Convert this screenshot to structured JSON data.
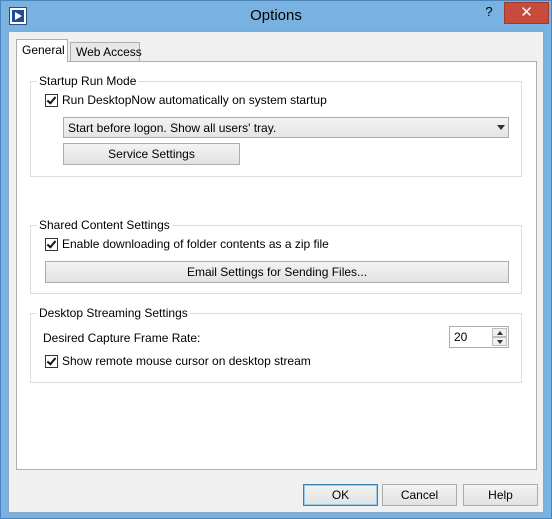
{
  "window": {
    "title": "Options",
    "help_glyph": "?",
    "close_glyph": "✕"
  },
  "tabs": [
    {
      "label": "General",
      "active": true
    },
    {
      "label": "Web Access",
      "active": false
    }
  ],
  "startup": {
    "group_title": "Startup Run Mode",
    "run_checkbox_label": "Run DesktopNow automatically on system startup",
    "run_checked": true,
    "mode_selected": "Start before logon. Show all users' tray.",
    "service_button": "Service Settings"
  },
  "shared": {
    "group_title": "Shared Content Settings",
    "zip_checkbox_label": "Enable downloading of folder contents as a zip file",
    "zip_checked": true,
    "email_button": "Email Settings for Sending Files..."
  },
  "streaming": {
    "group_title": "Desktop Streaming Settings",
    "frame_rate_label": "Desired Capture Frame Rate:",
    "frame_rate_value": "20",
    "cursor_checkbox_label": "Show remote mouse cursor on desktop stream",
    "cursor_checked": true
  },
  "footer": {
    "ok": "OK",
    "cancel": "Cancel",
    "help": "Help"
  }
}
